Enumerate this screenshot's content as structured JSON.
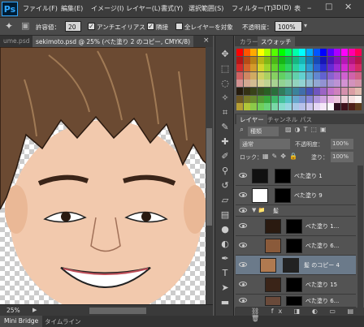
{
  "menubar": {
    "logo": "Ps",
    "items": [
      "ファイル(F)",
      "編集(E)",
      "イメージ(I)",
      "レイヤー(L)",
      "書式(Y)",
      "選択範囲(S)",
      "フィルター(T)",
      "3D(D)",
      "表"
    ]
  },
  "options": {
    "tolerance_label": "許容値：",
    "tolerance_value": "20",
    "antialias": "アンチエイリアス",
    "contiguous": "隣接",
    "all_layers": "全レイヤーを対象",
    "opacity_label": "不透明度：",
    "opacity_value": "100%"
  },
  "tabs": {
    "prev": "ume.psd",
    "active": "sekimoto.psd @ 25% (べた塗り 2 のコピー, CMYK/8)",
    "close": "×"
  },
  "status": {
    "zoom": "25%"
  },
  "bottom": {
    "mini_bridge": "Mini Bridge",
    "timeline": "タイムライン"
  },
  "swatch_panel": {
    "tab1": "カラー",
    "tab2": "スウォッチ"
  },
  "layers_panel": {
    "tab1": "レイヤー",
    "tab2": "チャンネル",
    "tab3": "パス",
    "kind": "種類",
    "blend": "通常",
    "opacity_label": "不透明度：",
    "opacity": "100%",
    "lock_label": "ロック：",
    "fill_label": "塗り：",
    "fill": "100%"
  },
  "layers": [
    {
      "name": "べた塗り 1",
      "color": "#111111"
    },
    {
      "name": "べた塗り 9",
      "color": "#ffffff"
    },
    {
      "name": "髪",
      "color": "group"
    },
    {
      "name": "べた塗り 1...",
      "color": "#2a1a10"
    },
    {
      "name": "べた塗り 6...",
      "color": "#8a5a3a"
    },
    {
      "name": "髪 のコピー 4",
      "color": "#b07a50"
    },
    {
      "name": "べた塗り 15",
      "color": "#3a2418"
    },
    {
      "name": "べた塗り 6...",
      "color": "#6a4a3a"
    }
  ],
  "colors": {
    "skin": "#f2c9ad",
    "hair": "#6b4a32",
    "accent": "#31a8ff"
  }
}
